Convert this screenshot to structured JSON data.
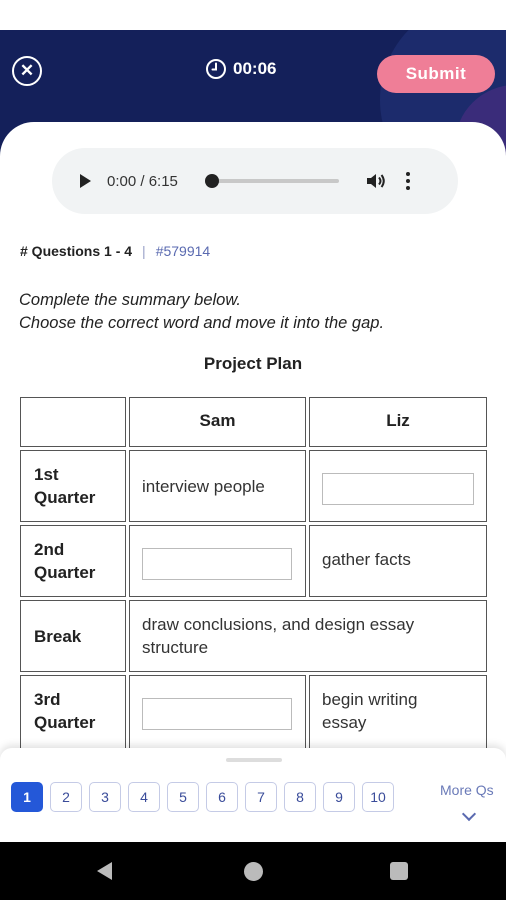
{
  "header": {
    "close_icon": "close-circle-icon",
    "timer_icon": "clock-icon",
    "timer": "00:06",
    "submit_label": "Submit",
    "background_color": "#14205a",
    "submit_color": "#ef7e97"
  },
  "audio": {
    "time": "0:00 / 6:15",
    "progress": 0,
    "play_icon": "play-icon",
    "volume_icon": "volume-icon",
    "more_icon": "more-vertical-icon"
  },
  "question": {
    "title": "# Questions 1 - 4",
    "separator": "|",
    "id": "#579914",
    "instruction_line1": "Complete the summary below.",
    "instruction_line2": "Choose the correct word and move it into the gap."
  },
  "table": {
    "title": "Project Plan",
    "headers": [
      "",
      "Sam",
      "Liz"
    ],
    "rows": [
      {
        "label_line1": "1st",
        "label_line2": "Quarter",
        "sam": "interview people",
        "liz": ""
      },
      {
        "label_line1": "2nd",
        "label_line2": "Quarter",
        "sam": "",
        "liz": "gather facts"
      },
      {
        "label_line1": "Break",
        "label_line2": "",
        "merged_line1": "draw conclusions, and design essay",
        "merged_line2": "structure"
      },
      {
        "label_line1": "3rd",
        "label_line2": "Quarter",
        "sam": "",
        "liz_line1": "begin writing",
        "liz_line2": "essay"
      }
    ]
  },
  "question_nav": {
    "numbers": [
      "1",
      "2",
      "3",
      "4",
      "5",
      "6",
      "7",
      "8",
      "9",
      "10"
    ],
    "active": "1",
    "more_label": "More Qs",
    "more_icon": "chevron-down-icon",
    "active_color": "#2458d8"
  },
  "system_nav": {
    "back_icon": "back-triangle-icon",
    "home_icon": "home-circle-icon",
    "recents_icon": "recents-square-icon"
  }
}
